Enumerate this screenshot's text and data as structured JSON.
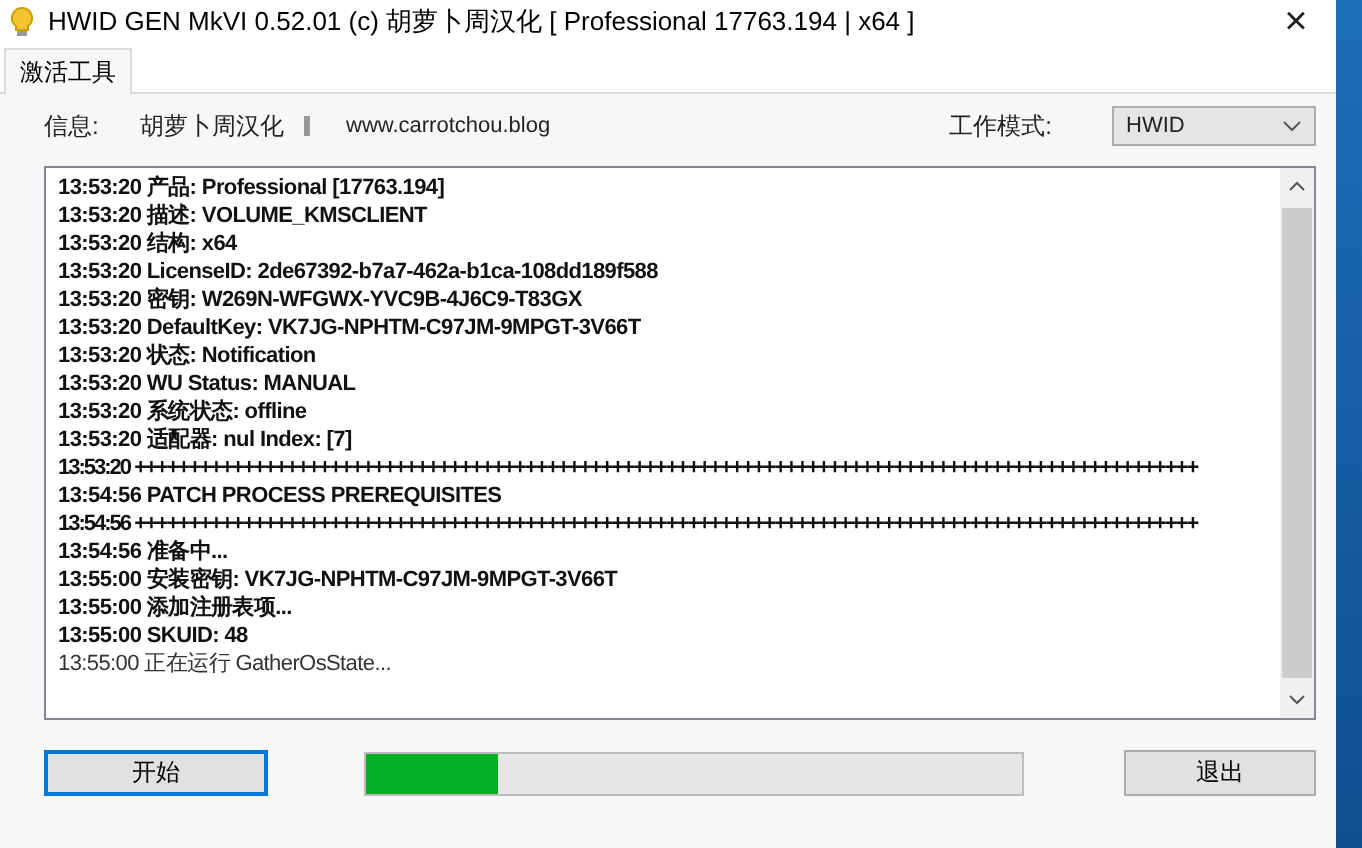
{
  "window": {
    "title": "HWID GEN MkVI 0.52.01 (c) 胡萝卜周汉化 [ Professional 17763.194 | x64 ]",
    "close": "×"
  },
  "tabs": [
    {
      "label": "激活工具",
      "selected": true
    }
  ],
  "info": {
    "label": "信息:",
    "author": "胡萝卜周汉化",
    "website": "www.carrotchou.blog",
    "mode_label": "工作模式:",
    "mode_value": "HWID"
  },
  "log": [
    {
      "kind": "line",
      "time": "13:53:20",
      "text": "产品: Professional [17763.194]",
      "bold": true
    },
    {
      "kind": "line",
      "time": "13:53:20",
      "text": "描述: VOLUME_KMSCLIENT",
      "bold": true
    },
    {
      "kind": "line",
      "time": "13:53:20",
      "text": "结构: x64",
      "bold": true
    },
    {
      "kind": "line",
      "time": "13:53:20",
      "text": "LicenseID: 2de67392-b7a7-462a-b1ca-108dd189f588",
      "bold": true
    },
    {
      "kind": "line",
      "time": "13:53:20",
      "text": "密钥: W269N-WFGWX-YVC9B-4J6C9-T83GX",
      "bold": true
    },
    {
      "kind": "line",
      "time": "13:53:20",
      "text": "DefaultKey: VK7JG-NPHTM-C97JM-9MPGT-3V66T",
      "bold": true
    },
    {
      "kind": "line",
      "time": "13:53:20",
      "text": "状态: Notification",
      "bold": true
    },
    {
      "kind": "line",
      "time": "13:53:20",
      "text": "WU Status: MANUAL",
      "bold": true
    },
    {
      "kind": "line",
      "time": "13:53:20",
      "text": "系统状态: offline",
      "bold": true
    },
    {
      "kind": "line",
      "time": "13:53:20",
      "text": "适配器: nul Index: [7]",
      "bold": true
    },
    {
      "kind": "separator",
      "time": "13:53:20",
      "text": "++++++++++++++++++++++++++++++++++++++++++++++++++++++++++++++++++++++++++++++++++++++++++++++++++",
      "bold": true
    },
    {
      "kind": "line",
      "time": "13:54:56",
      "text": "PATCH PROCESS PREREQUISITES",
      "bold": true
    },
    {
      "kind": "separator",
      "time": "13:54:56",
      "text": "++++++++++++++++++++++++++++++++++++++++++++++++++++++++++++++++++++++++++++++++++++++++++++++++++",
      "bold": true
    },
    {
      "kind": "line",
      "time": "13:54:56",
      "text": "准备中...",
      "bold": true
    },
    {
      "kind": "line",
      "time": "13:55:00",
      "text": "安装密钥: VK7JG-NPHTM-C97JM-9MPGT-3V66T",
      "bold": true
    },
    {
      "kind": "line",
      "time": "13:55:00",
      "text": "添加注册表项...",
      "bold": true
    },
    {
      "kind": "line",
      "time": "13:55:00",
      "text": "SKUID: 48",
      "bold": true
    },
    {
      "kind": "line",
      "time": "13:55:00",
      "text": "正在运行 GatherOsState...",
      "bold": false
    }
  ],
  "start_button": "开始",
  "progress": {
    "level": 0.2
  },
  "exit_button": "退出"
}
